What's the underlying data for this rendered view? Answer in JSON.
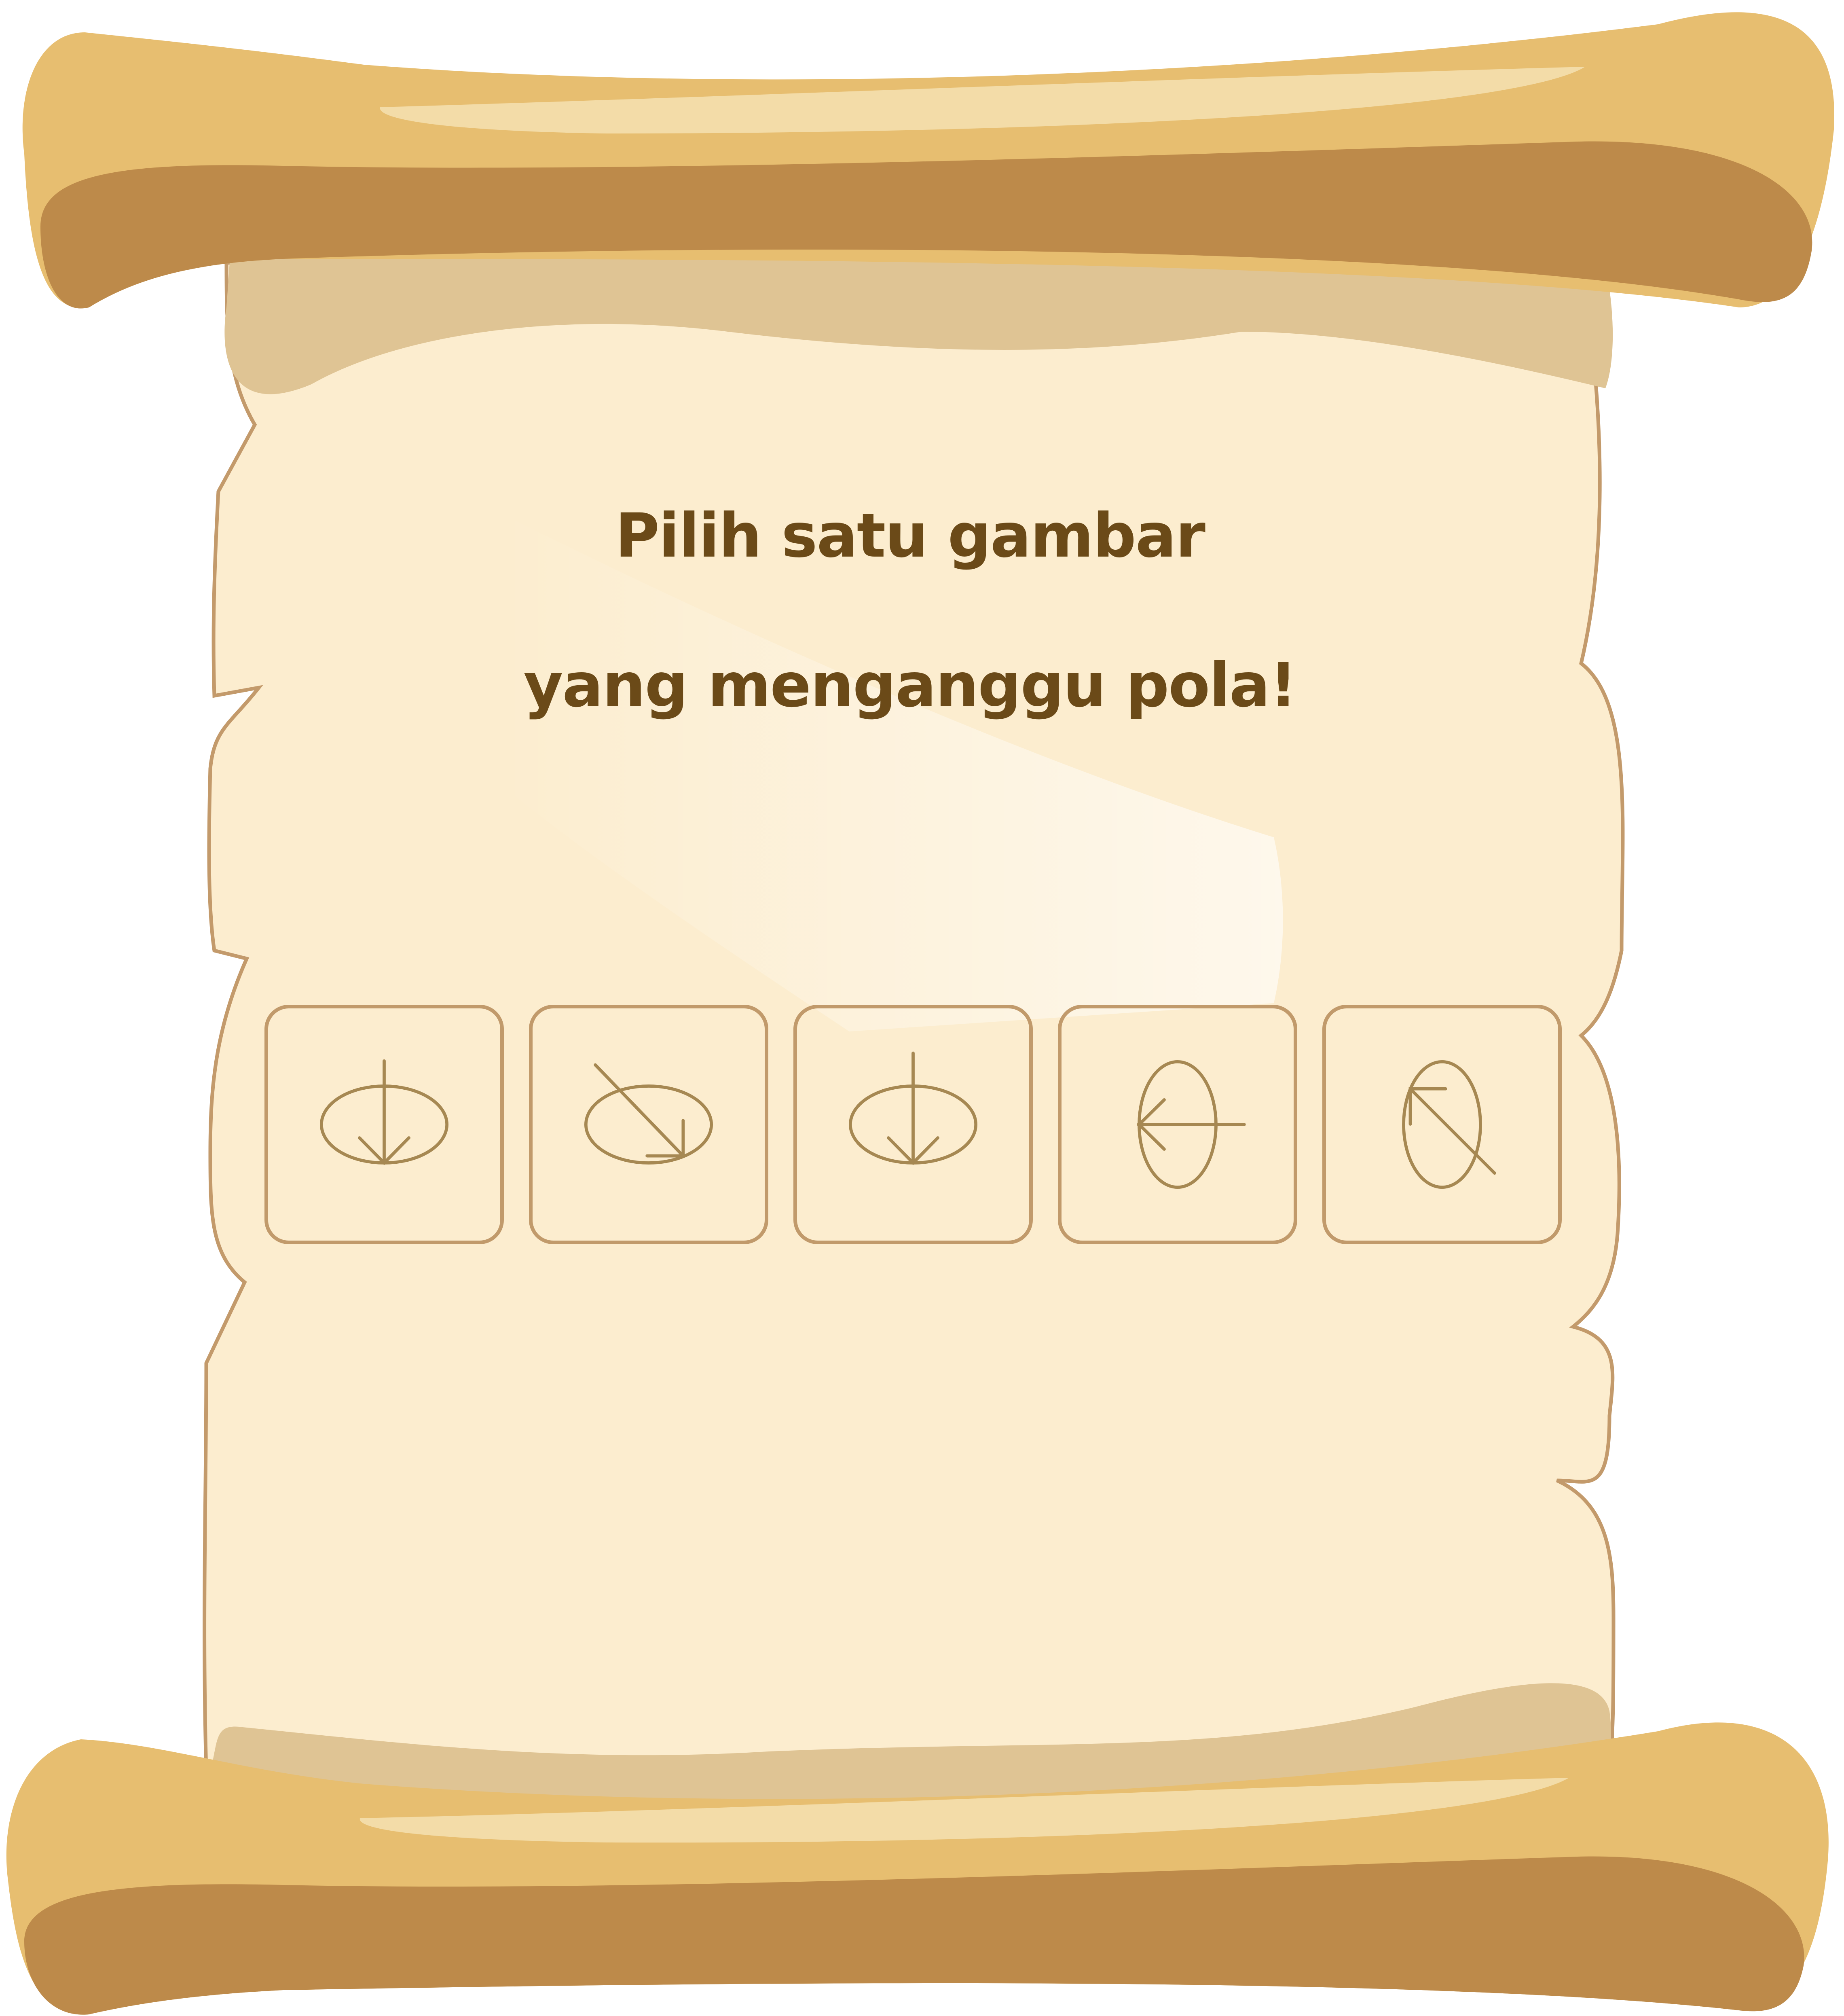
{
  "prompt": {
    "line1": "Pilih satu gambar",
    "line2": "yang menganggu pola!"
  },
  "choices": [
    {
      "id": "choice-1",
      "ellipse": "horizontal",
      "arrow": "down"
    },
    {
      "id": "choice-2",
      "ellipse": "horizontal",
      "arrow": "down-right"
    },
    {
      "id": "choice-3",
      "ellipse": "horizontal",
      "arrow": "down"
    },
    {
      "id": "choice-4",
      "ellipse": "vertical",
      "arrow": "left"
    },
    {
      "id": "choice-5",
      "ellipse": "vertical",
      "arrow": "up-left"
    }
  ],
  "colors": {
    "parchment": "#fcedcf",
    "parchment_edge": "#c39a6b",
    "parchment_shade": "#dfc494",
    "roller": "#e7be70",
    "roller_dark": "#bd8a4a",
    "roller_highlight": "#f3dca8",
    "prompt_text": "#6b4a18",
    "choice_border": "#c19a6b",
    "figure_stroke": "#a68852"
  }
}
